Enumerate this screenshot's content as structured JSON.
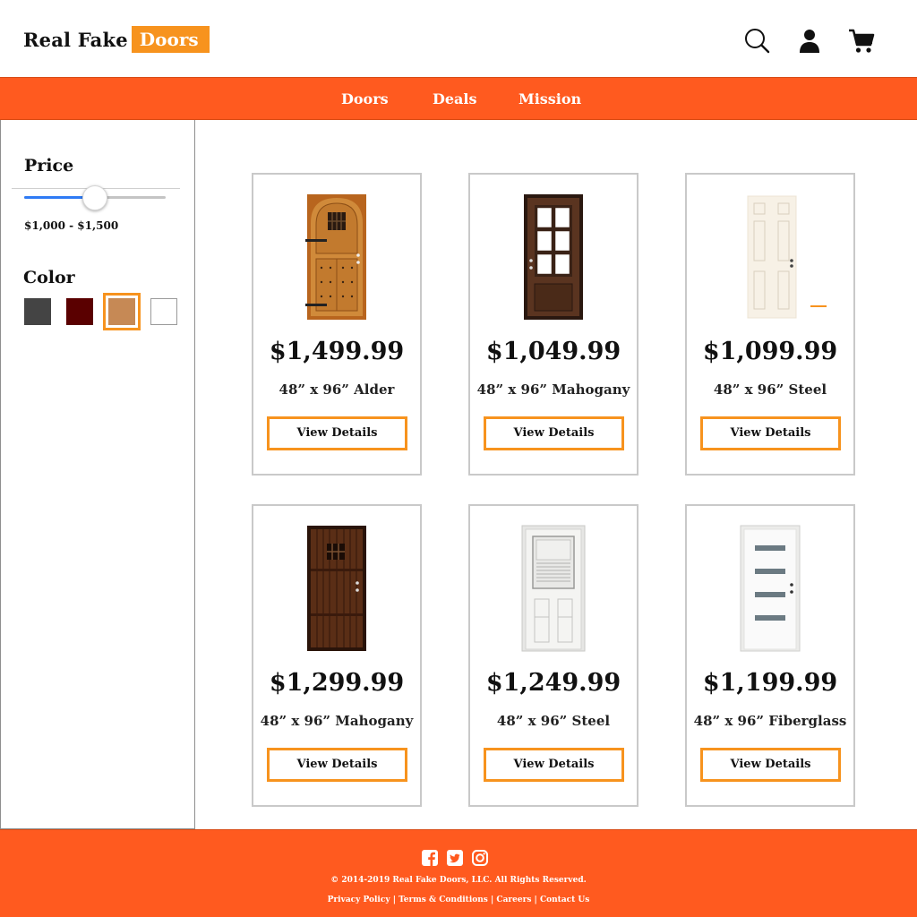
{
  "brand": {
    "name": "Real Fake",
    "highlight": "Doors",
    "accent_color": "#f7931e"
  },
  "header": {
    "icons": [
      "search-icon",
      "user-icon",
      "cart-icon"
    ]
  },
  "nav": {
    "color": "#ff5a1f",
    "items": [
      {
        "label": "Doors"
      },
      {
        "label": "Deals"
      },
      {
        "label": "Mission"
      }
    ]
  },
  "filters": {
    "price": {
      "title": "Price",
      "range_label": "$1,000 - $1,500",
      "slider_value_fraction": 0.5
    },
    "color": {
      "title": "Color",
      "swatches": [
        {
          "name": "charcoal",
          "hex": "#444444",
          "selected": false
        },
        {
          "name": "dark-red",
          "hex": "#5a0000",
          "selected": false
        },
        {
          "name": "tan",
          "hex": "#c68955",
          "selected": true
        },
        {
          "name": "white",
          "hex": "#ffffff",
          "selected": false
        }
      ]
    }
  },
  "products": [
    {
      "price": "$1,499.99",
      "description": "48” x 96” Alder",
      "button": "View Details",
      "door_style": "wood-arched",
      "door_color": "#c9762a"
    },
    {
      "price": "$1,049.99",
      "description": "48” x 96” Mahogany",
      "button": "View Details",
      "door_style": "glass-grid",
      "door_color": "#4a2a1a"
    },
    {
      "price": "$1,099.99",
      "description": "48” x 96” Steel",
      "button": "View Details",
      "door_style": "six-panel",
      "door_color": "#f7f1e6"
    },
    {
      "price": "$1,299.99",
      "description": "48” x 96” Mahogany",
      "button": "View Details",
      "door_style": "wood-plank",
      "door_color": "#4a2412"
    },
    {
      "price": "$1,249.99",
      "description": "48” x 96” Steel",
      "button": "View Details",
      "door_style": "half-glass",
      "door_color": "#f4f4f2"
    },
    {
      "price": "$1,199.99",
      "description": "48” x 96” Fiberglass",
      "button": "View Details",
      "door_style": "modern-slots",
      "door_color": "#fafafa"
    }
  ],
  "footer": {
    "social_icons": [
      "facebook-icon",
      "twitter-icon",
      "instagram-icon"
    ],
    "copyright": "© 2014-2019 Real Fake Doors, LLC. All Rights Reserved.",
    "links": [
      {
        "label": "Privacy Policy"
      },
      {
        "label": "Terms & Conditions"
      },
      {
        "label": "Careers"
      },
      {
        "label": "Contact Us"
      }
    ],
    "separator": " | "
  }
}
